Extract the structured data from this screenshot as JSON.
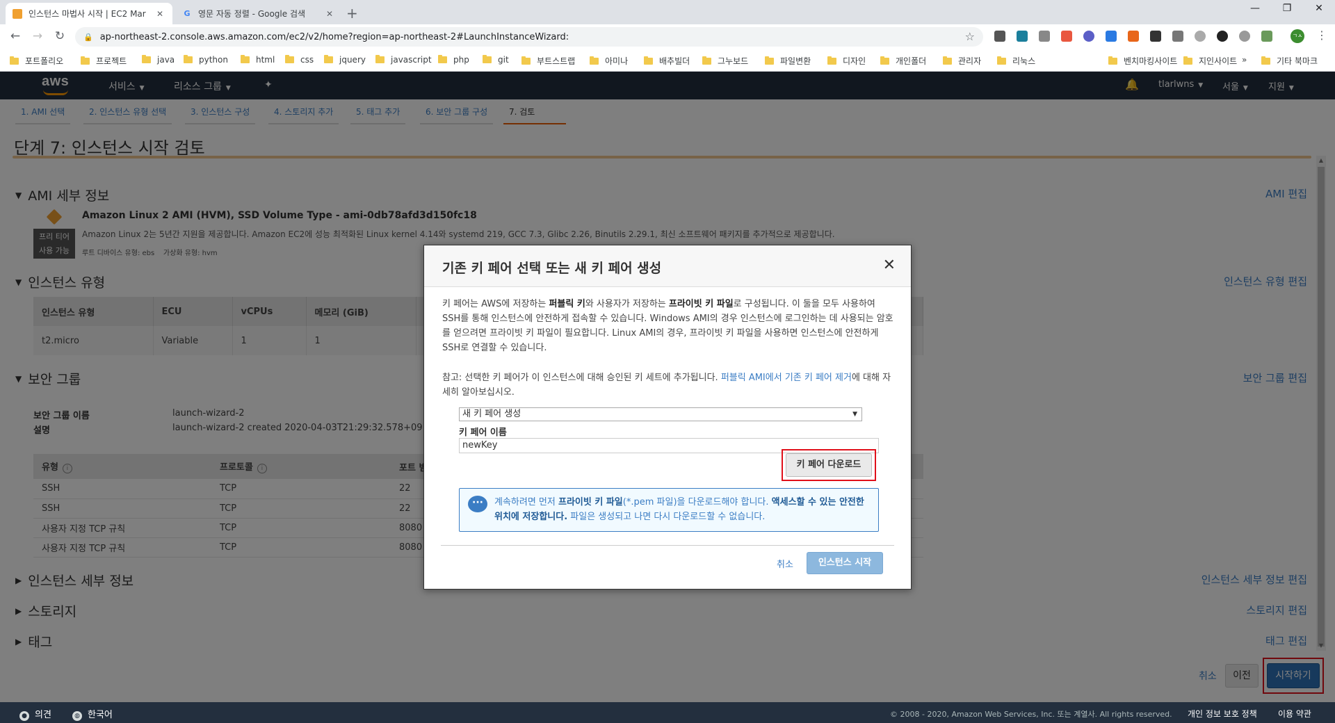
{
  "browser": {
    "tabs": [
      {
        "title": "인스턴스 마법사 시작 | EC2 Mar",
        "active": true
      },
      {
        "title": "영문 자동 정렬 - Google 검색",
        "active": false
      }
    ],
    "url": "ap-northeast-2.console.aws.amazon.com/ec2/v2/home?region=ap-northeast-2#LaunchInstanceWizard:",
    "profile_initials": "ㄱㅅ",
    "bookmarks": [
      "포트폴리오",
      "프로젝트",
      "java",
      "python",
      "html",
      "css",
      "jquery",
      "javascript",
      "php",
      "git",
      "부트스트랩",
      "아미나",
      "배추빌더",
      "그누보드",
      "파일변환",
      "디자인",
      "개인폴더",
      "관리자",
      "리눅스",
      "벤치마킹사이트",
      "지인사이트"
    ],
    "bookmarks_more": "»",
    "other_bookmarks": "기타 북마크"
  },
  "aws_nav": {
    "logo": "aws",
    "services": "서비스",
    "resource_groups": "리소스 그룹",
    "user": "tlarlwns",
    "region": "서울",
    "support": "지원"
  },
  "wizard_steps": [
    "1. AMI 선택",
    "2. 인스턴스 유형 선택",
    "3. 인스턴스 구성",
    "4. 스토리지 추가",
    "5. 태그 추가",
    "6. 보안 그룹 구성",
    "7. 검토"
  ],
  "page_title": "단계 7: 인스턴스 시작 검토",
  "ami": {
    "header": "AMI 세부 정보",
    "edit": "AMI 편집",
    "name": "Amazon Linux 2 AMI (HVM), SSD Volume Type - ami-0db78afd3d150fc18",
    "badge_line1": "프리 티어",
    "badge_line2": "사용 가능",
    "description": "Amazon Linux 2는 5년간 지원을 제공합니다. Amazon EC2에 성능 최적화된 Linux kernel 4.14와 systemd 219, GCC 7.3, Glibc 2.26, Binutils 2.29.1, 최신 소프트웨어 패키지를 추가적으로 제공합니다.",
    "meta": "루트 디바이스 유형: ebs    가상화 유형: hvm"
  },
  "instance_type": {
    "header": "인스턴스 유형",
    "edit": "인스턴스 유형 편집",
    "columns": [
      "인스턴스 유형",
      "ECU",
      "vCPUs",
      "메모리 (GiB)",
      ""
    ],
    "row": [
      "t2.micro",
      "Variable",
      "1",
      "1",
      ""
    ]
  },
  "security_group": {
    "header": "보안 그룹",
    "edit": "보안 그룹 편집",
    "name_label": "보안 그룹 이름",
    "name_value": "launch-wizard-2",
    "desc_label": "설명",
    "desc_value": "launch-wizard-2 created 2020-04-03T21:29:32.578+09:00",
    "columns": [
      "유형",
      "프로토콜",
      "포트 범"
    ],
    "rows": [
      [
        "SSH",
        "TCP",
        "22"
      ],
      [
        "SSH",
        "TCP",
        "22"
      ],
      [
        "사용자 지정 TCP 규칙",
        "TCP",
        "8080"
      ],
      [
        "사용자 지정 TCP 규칙",
        "TCP",
        "8080"
      ]
    ]
  },
  "collapsed_sections": [
    {
      "header": "인스턴스 세부 정보",
      "edit": "인스턴스 세부 정보 편집"
    },
    {
      "header": "스토리지",
      "edit": "스토리지 편집"
    },
    {
      "header": "태그",
      "edit": "태그 편집"
    }
  ],
  "bottom_buttons": {
    "cancel": "취소",
    "prev": "이전",
    "launch": "시작하기"
  },
  "footer": {
    "feedback": "의견",
    "language": "한국어",
    "copyright": "© 2008 - 2020, Amazon Web Services, Inc. 또는 계열사. All rights reserved.",
    "privacy": "개인 정보 보호 정책",
    "terms": "이용 약관"
  },
  "modal": {
    "title": "기존 키 페어 선택 또는 새 키 페어 생성",
    "para1_a": "키 페어는 AWS에 저장하는 ",
    "para1_b": "퍼블릭 키",
    "para1_c": "와 사용자가 저장하는 ",
    "para1_d": "프라이빗 키 파일",
    "para1_e": "로 구성됩니다. 이 둘을 모두 사용하여 SSH를 통해 인스턴스에 안전하게 접속할 수 있습니다. Windows AMI의 경우 인스턴스에 로그인하는 데 사용되는 암호를 얻으려면 프라이빗 키 파일이 필요합니다. Linux AMI의 경우, 프라이빗 키 파일을 사용하면 인스턴스에 안전하게 SSH로 연결할 수 있습니다.",
    "para2_a": "참고: 선택한 키 페어가 이 인스턴스에 대해 승인된 키 세트에 추가됩니다. ",
    "para2_link": "퍼블릭 AMI에서 기존 키 페어 제거",
    "para2_b": "에 대해 자세히 알아보십시오.",
    "select_value": "새 키 페어 생성",
    "keyname_label": "키 페어 이름",
    "keyname_value": "newKey",
    "download": "키 페어 다운로드",
    "info_a": "계속하려면 먼저 ",
    "info_b": "프라이빗 키 파일",
    "info_c": "(*.pem 파일)을 다운로드해야 합니다. ",
    "info_d": "액세스할 수 있는 안전한 위치에 저장합니다.",
    "info_e": " 파일은 생성되고 나면 다시 다운로드할 수 없습니다.",
    "cancel": "취소",
    "launch": "인스턴스 시작"
  },
  "colors": {
    "aws_nav": "#232f3e",
    "accent": "#ff9900",
    "link": "#3b7dc4",
    "highlight": "#e0101a"
  }
}
